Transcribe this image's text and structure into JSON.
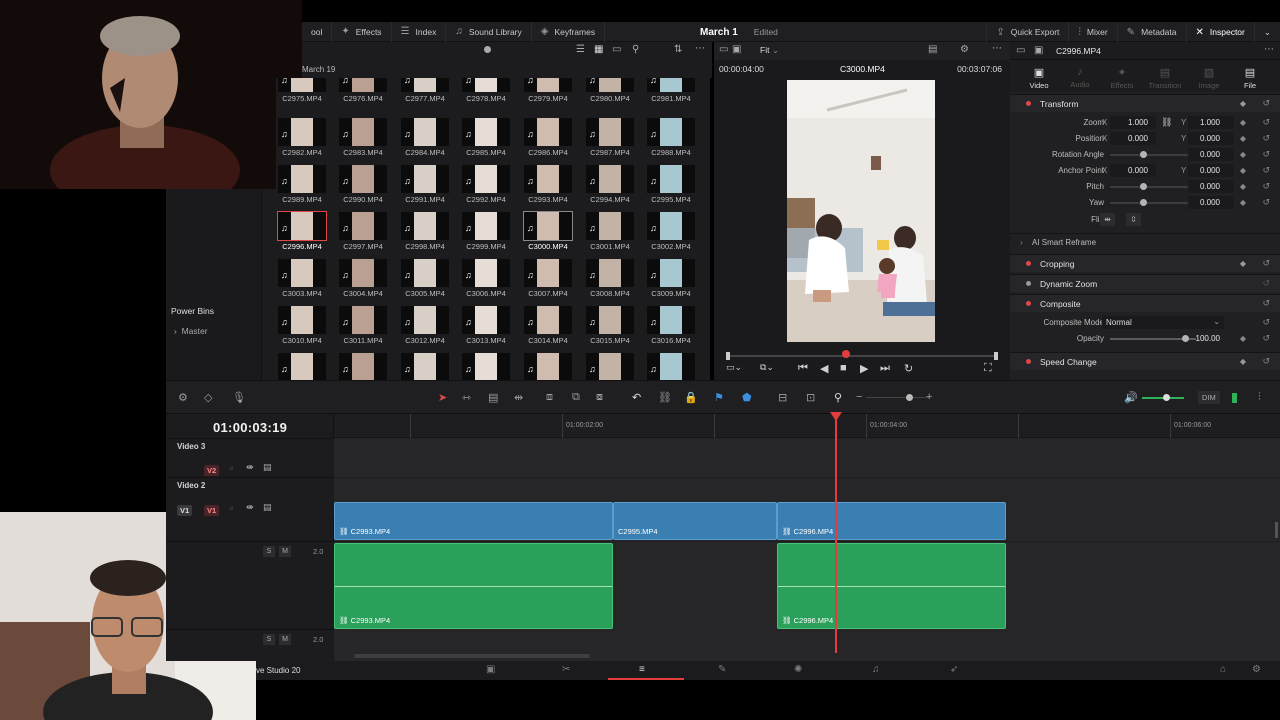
{
  "topbar": {
    "left_items": [
      {
        "icon": "tool-icon",
        "label": "ool"
      },
      {
        "icon": "effects-icon",
        "label": "Effects"
      },
      {
        "icon": "index-icon",
        "label": "Index"
      },
      {
        "icon": "sound-library-icon",
        "label": "Sound Library"
      },
      {
        "icon": "keyframes-icon",
        "label": "Keyframes"
      }
    ],
    "project_name": "March 1",
    "project_status": "Edited",
    "right_items": [
      {
        "icon": "quick-export-icon",
        "label": "Quick Export"
      },
      {
        "icon": "mixer-icon",
        "label": "Mixer"
      },
      {
        "icon": "metadata-icon",
        "label": "Metadata"
      },
      {
        "icon": "inspector-icon",
        "label": "Inspector"
      }
    ]
  },
  "media_pool": {
    "bin_path": "March 19",
    "power_bins_title": "Power Bins",
    "power_bins_item": "Master",
    "clips": [
      "C2975.MP4",
      "C2976.MP4",
      "C2977.MP4",
      "C2978.MP4",
      "C2979.MP4",
      "C2980.MP4",
      "C2981.MP4",
      "C2982.MP4",
      "C2983.MP4",
      "C2984.MP4",
      "C2985.MP4",
      "C2986.MP4",
      "C2987.MP4",
      "C2988.MP4",
      "C2989.MP4",
      "C2990.MP4",
      "C2991.MP4",
      "C2992.MP4",
      "C2993.MP4",
      "C2994.MP4",
      "C2995.MP4",
      "C2996.MP4",
      "C2997.MP4",
      "C2998.MP4",
      "C2999.MP4",
      "C3000.MP4",
      "C3001.MP4",
      "C3002.MP4",
      "C3003.MP4",
      "C3004.MP4",
      "C3005.MP4",
      "C3006.MP4",
      "C3007.MP4",
      "C3008.MP4",
      "C3009.MP4",
      "C3010.MP4",
      "C3011.MP4",
      "C3012.MP4",
      "C3013.MP4",
      "C3014.MP4",
      "C3015.MP4",
      "C3016.MP4",
      "",
      "",
      "",
      "",
      "",
      "",
      ""
    ],
    "first_col_visible_labels": [
      "MP4",
      "MP4",
      "C2989.MP4",
      "C2996.MP4",
      "C3003.MP4",
      "C3010.MP4",
      ""
    ],
    "selected_clip": "C2996.MP4",
    "current_clip": "C3000.MP4"
  },
  "viewer": {
    "fit_label": "Fit",
    "timecode_left": "00:00:04:00",
    "clip_name": "C3000.MP4",
    "timecode_right": "00:03:07:06"
  },
  "inspector": {
    "file_name": "C2996.MP4",
    "tabs": [
      "Video",
      "Audio",
      "Effects",
      "Transition",
      "Image",
      "File"
    ],
    "active_tab": "Video",
    "transform": {
      "title": "Transform",
      "zoom_label": "Zoom",
      "zoom_x": "1.000",
      "zoom_y": "1.000",
      "position_label": "Position",
      "position_x": "0.000",
      "position_y": "0.000",
      "rotation_label": "Rotation Angle",
      "rotation": "0.000",
      "anchor_label": "Anchor Point",
      "anchor_x": "0.000",
      "anchor_y": "0.000",
      "pitch_label": "Pitch",
      "pitch": "0.000",
      "yaw_label": "Yaw",
      "yaw": "0.000",
      "flip_label": "Flip",
      "x": "X",
      "y": "Y"
    },
    "smart_reframe": "AI Smart Reframe",
    "cropping": "Cropping",
    "dynamic_zoom": "Dynamic Zoom",
    "composite": {
      "title": "Composite",
      "mode_label": "Composite Mode",
      "mode_value": "Normal",
      "opacity_label": "Opacity",
      "opacity_value": "100.00"
    },
    "speed_change": "Speed Change"
  },
  "timeline": {
    "timecode": "01:00:03:19",
    "ruler_labels": [
      "01:00:02:00",
      "01:00:04:00",
      "01:00:06:00"
    ],
    "tracks": {
      "video3": "Video 3",
      "v2_tag": "V2",
      "video2": "Video 2",
      "v1_tag": "V1",
      "v1_src_tag": "V1",
      "audio_level_1": "2.0",
      "audio_level_2": "2.0",
      "solo": "S",
      "mute": "M"
    },
    "video_clips": [
      "C2993.MP4",
      "C2995.MP4",
      "C2996.MP4"
    ],
    "audio_clips": [
      "C2993.MP4",
      "C2996.MP4"
    ]
  },
  "bottom": {
    "app_version": "ve Studio 20"
  },
  "colors": {
    "video_clip": "#3a7fb2",
    "audio_clip": "#2aa05a",
    "playhead": "#e43b3b",
    "accent_red": "#e04848"
  }
}
